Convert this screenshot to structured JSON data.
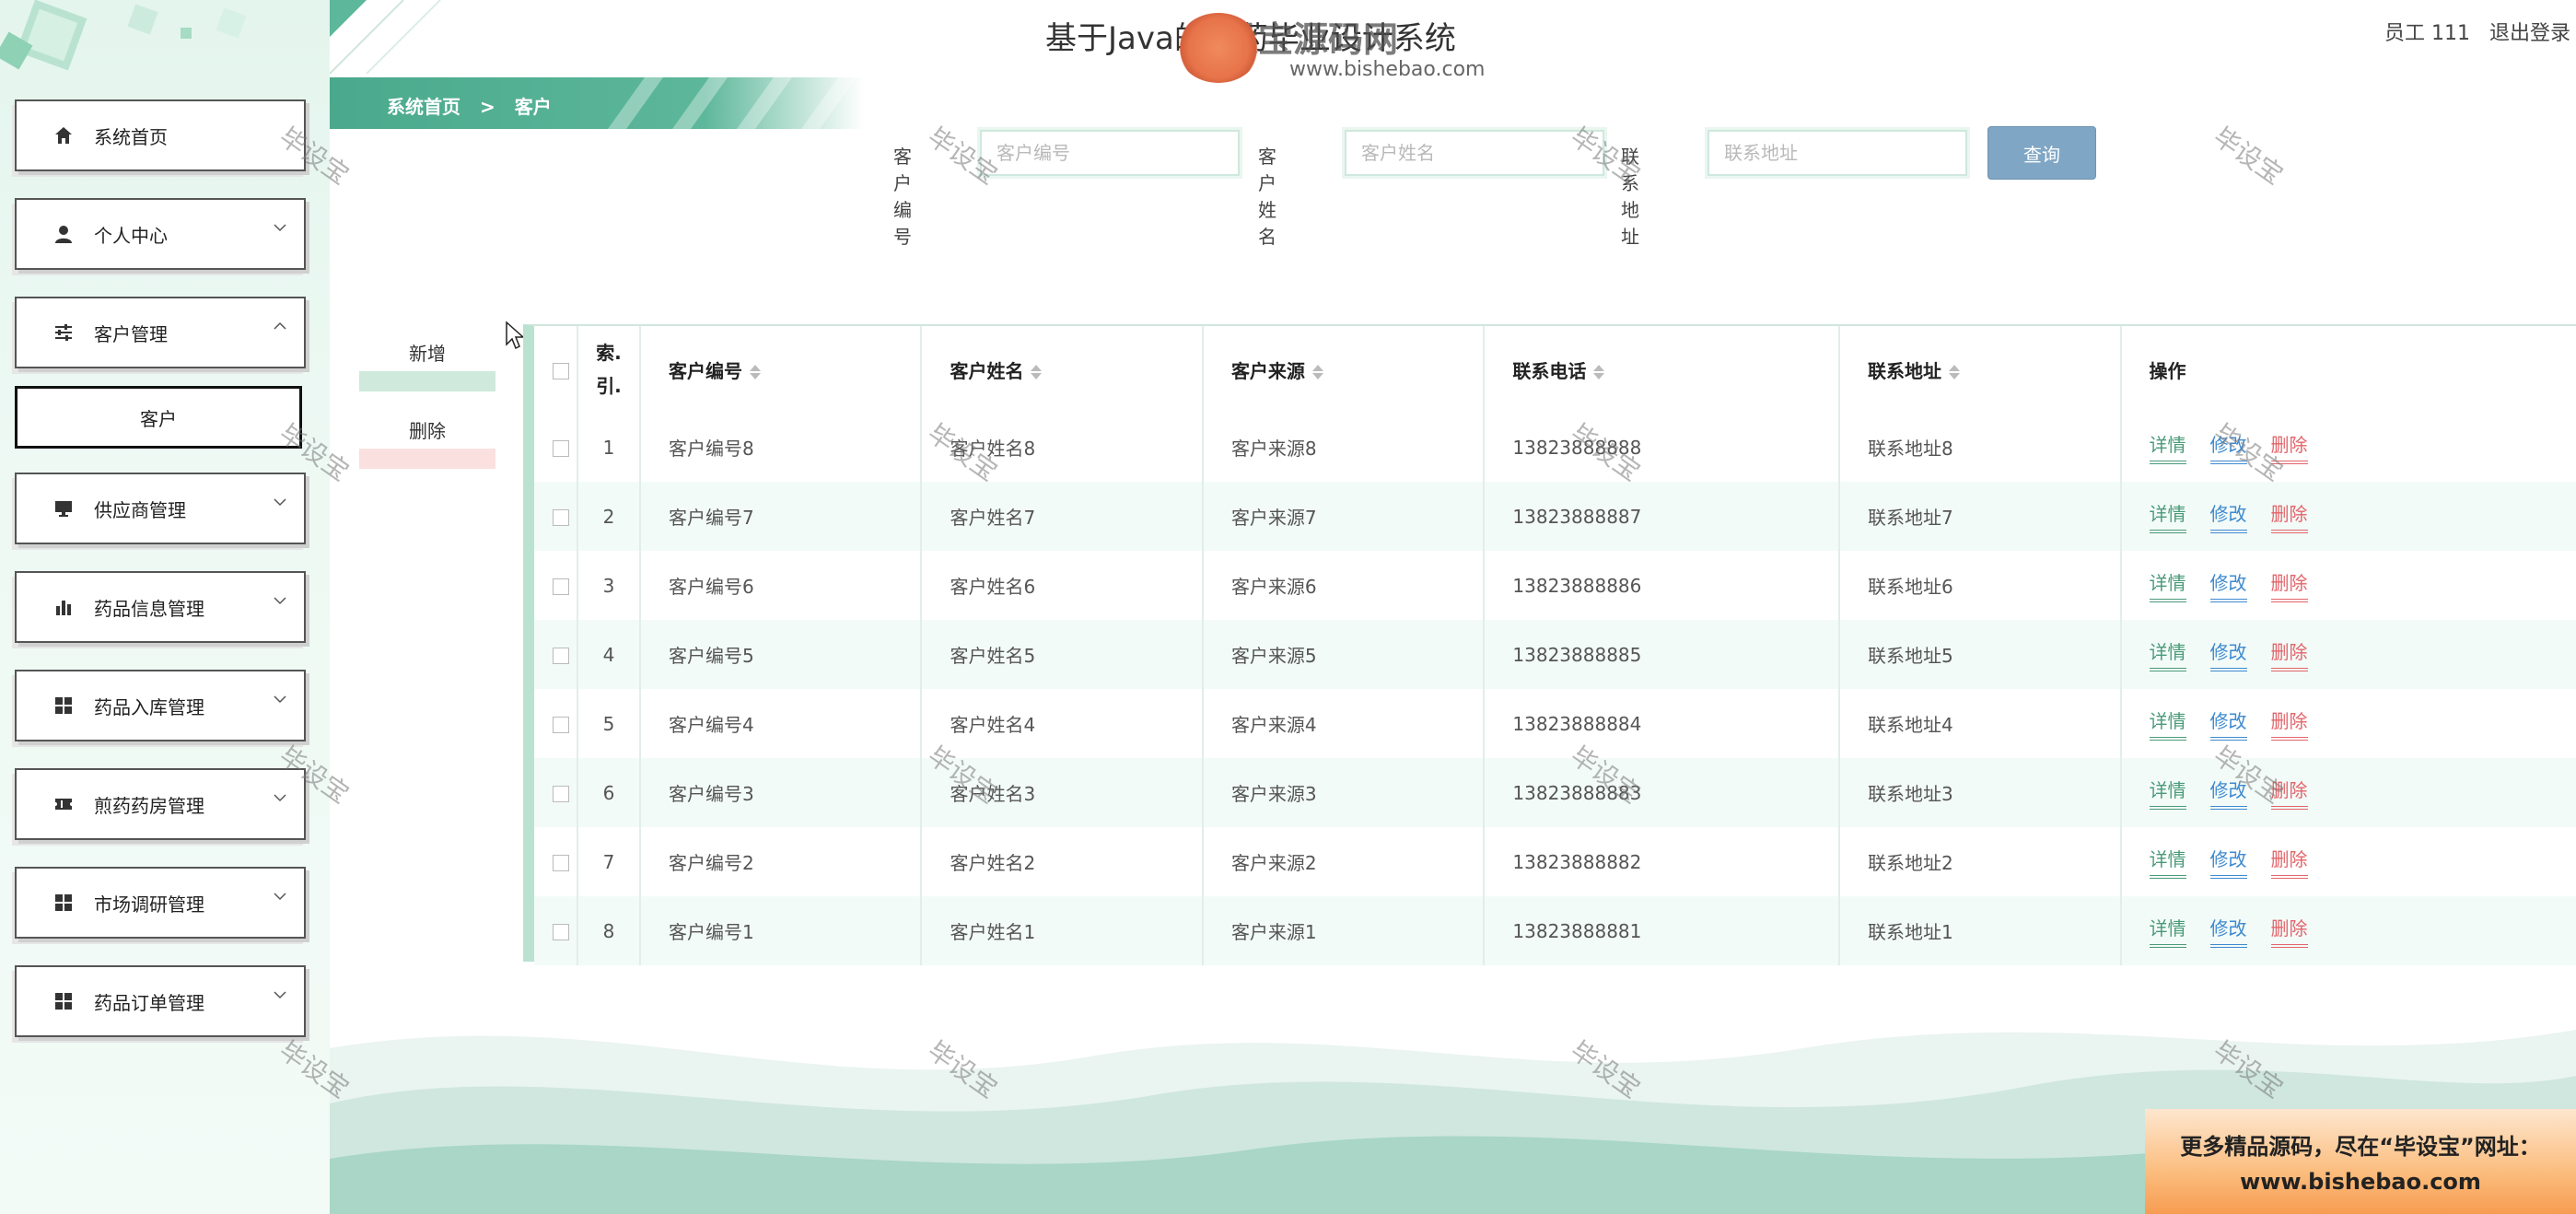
{
  "app": {
    "title": "基于Java的中药毕业设计系统"
  },
  "watermark": {
    "logo_title": "毕设宝源码网",
    "logo_url": "www.bishebao.com",
    "text": "毕设宝"
  },
  "user": {
    "name": "员工 111",
    "logout": "退出登录"
  },
  "breadcrumb": {
    "home": "系统首页",
    "separator": ">",
    "current": "客户"
  },
  "sidebar": {
    "items": [
      {
        "label": "系统首页",
        "icon": "home-icon"
      },
      {
        "label": "个人中心",
        "icon": "user-icon"
      },
      {
        "label": "客户管理",
        "icon": "sliders-icon",
        "expanded": true,
        "sub": "客户"
      },
      {
        "label": "供应商管理",
        "icon": "monitor-icon"
      },
      {
        "label": "药品信息管理",
        "icon": "bar-chart-icon"
      },
      {
        "label": "药品入库管理",
        "icon": "grid-icon"
      },
      {
        "label": "煎药药房管理",
        "icon": "ticket-icon"
      },
      {
        "label": "市场调研管理",
        "icon": "grid-icon"
      },
      {
        "label": "药品订单管理",
        "icon": "grid-icon"
      }
    ]
  },
  "search": {
    "fields": [
      {
        "label": "客户编号",
        "placeholder": "客户编号"
      },
      {
        "label": "客户姓名",
        "placeholder": "客户姓名"
      },
      {
        "label": "联系地址",
        "placeholder": "联系地址"
      }
    ],
    "button": "查询"
  },
  "actions": {
    "add": "新增",
    "delete": "删除"
  },
  "table": {
    "columns": [
      "索引",
      "客户编号",
      "客户姓名",
      "客户来源",
      "联系电话",
      "联系地址",
      "操作"
    ],
    "index_header": "索.\n引.",
    "ops": {
      "detail": "详情",
      "edit": "修改",
      "delete": "删除"
    },
    "rows": [
      {
        "idx": "1",
        "code": "客户编号8",
        "name": "客户姓名8",
        "source": "客户来源8",
        "phone": "13823888888",
        "address": "联系地址8"
      },
      {
        "idx": "2",
        "code": "客户编号7",
        "name": "客户姓名7",
        "source": "客户来源7",
        "phone": "13823888887",
        "address": "联系地址7"
      },
      {
        "idx": "3",
        "code": "客户编号6",
        "name": "客户姓名6",
        "source": "客户来源6",
        "phone": "13823888886",
        "address": "联系地址6"
      },
      {
        "idx": "4",
        "code": "客户编号5",
        "name": "客户姓名5",
        "source": "客户来源5",
        "phone": "13823888885",
        "address": "联系地址5"
      },
      {
        "idx": "5",
        "code": "客户编号4",
        "name": "客户姓名4",
        "source": "客户来源4",
        "phone": "13823888884",
        "address": "联系地址4"
      },
      {
        "idx": "6",
        "code": "客户编号3",
        "name": "客户姓名3",
        "source": "客户来源3",
        "phone": "13823888883",
        "address": "联系地址3"
      },
      {
        "idx": "7",
        "code": "客户编号2",
        "name": "客户姓名2",
        "source": "客户来源2",
        "phone": "13823888882",
        "address": "联系地址2"
      },
      {
        "idx": "8",
        "code": "客户编号1",
        "name": "客户姓名1",
        "source": "客户来源1",
        "phone": "13823888881",
        "address": "联系地址1"
      }
    ]
  },
  "promo": {
    "line1": "更多精品源码，尽在“毕设宝”网址：",
    "line2": "www.bishebao.com"
  },
  "colors": {
    "accent": "#5db79a",
    "button": "#7fa6c5",
    "detail": "#4a9a7a",
    "edit": "#3e8ad0",
    "delete": "#e2646a"
  }
}
